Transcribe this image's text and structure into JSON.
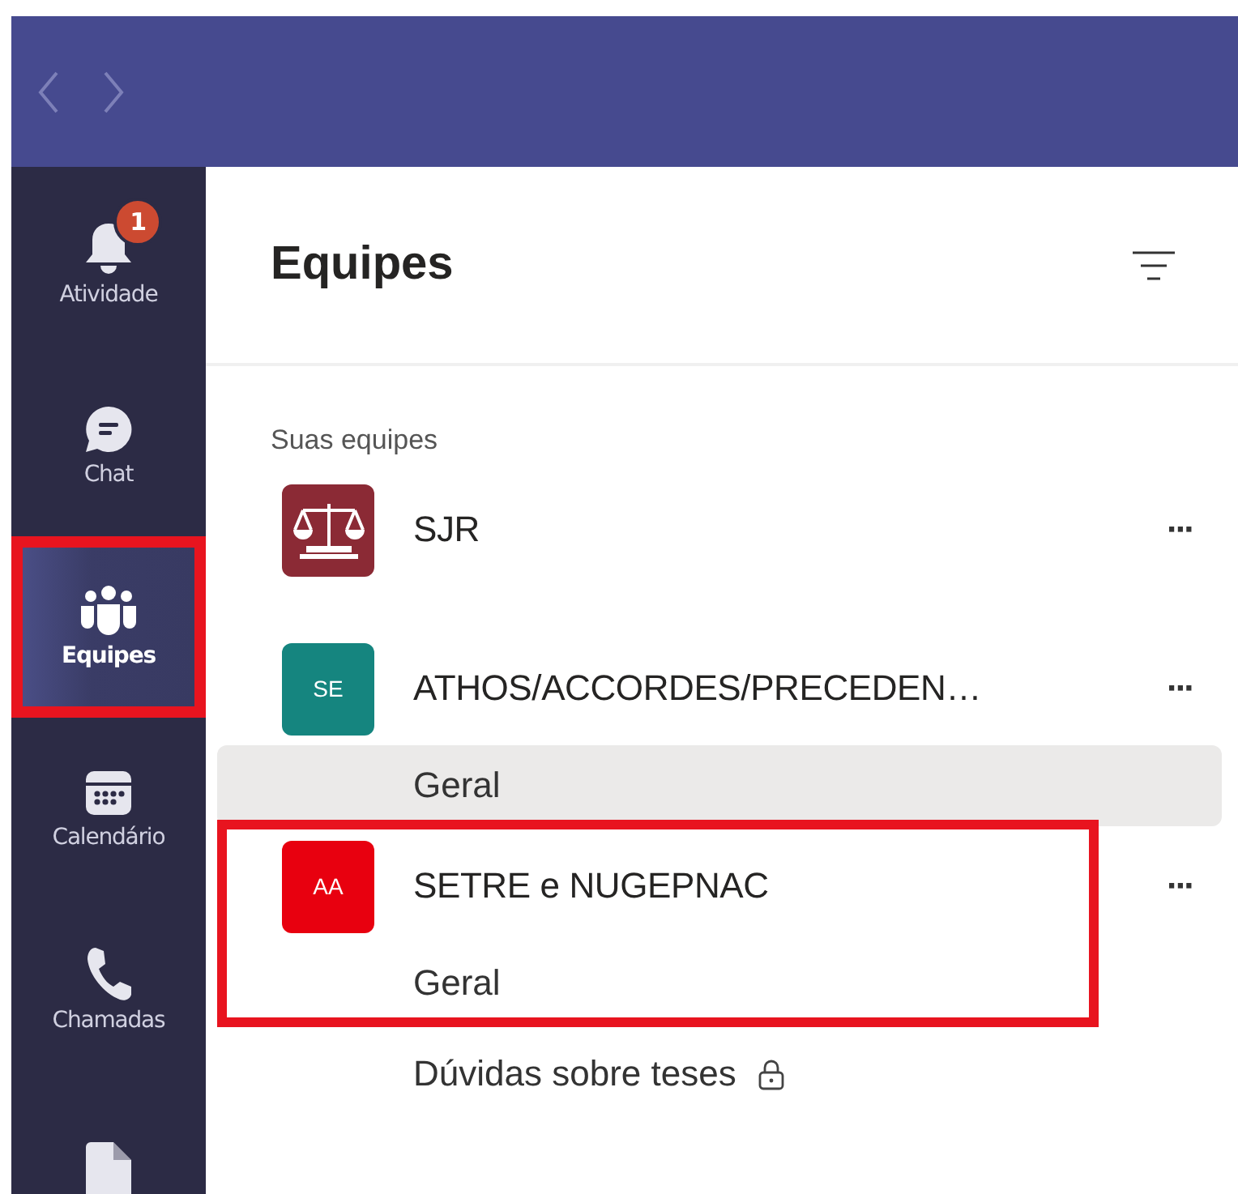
{
  "nav_buttons": [
    {
      "kind": "back"
    },
    {
      "kind": "forward"
    }
  ],
  "rail": {
    "items": [
      {
        "label": "Atividade",
        "kind": "bell",
        "badge": "1",
        "selected": false,
        "highlighted": false
      },
      {
        "label": "Chat",
        "kind": "chat",
        "selected": false,
        "highlighted": false
      },
      {
        "label": "Equipes",
        "kind": "teams",
        "selected": true,
        "highlighted": true
      },
      {
        "label": "Calendário",
        "kind": "calendar",
        "selected": false,
        "highlighted": false
      },
      {
        "label": "Chamadas",
        "kind": "phone",
        "selected": false,
        "highlighted": false
      },
      {
        "kind": "file",
        "selected": false,
        "highlighted": false
      }
    ]
  },
  "panel": {
    "title": "Equipes",
    "section": "Suas equipes",
    "teams": [
      {
        "name": "SJR",
        "avatar": {
          "kind": "logo",
          "color": "#8b2a35"
        },
        "highlighted": false,
        "more": "···"
      },
      {
        "name": "ATHOS/ACCORDES/PRECEDEN…",
        "avatar": {
          "kind": "initials",
          "initials": "SE",
          "color": "#15857f"
        },
        "highlighted": false,
        "more": "···",
        "channels": [
          {
            "name": "Geral",
            "selected": true,
            "private": false
          }
        ]
      },
      {
        "name": "SETRE e NUGEPNAC",
        "avatar": {
          "kind": "initials",
          "initials": "AA",
          "color": "#e8000f"
        },
        "highlighted": true,
        "more": "···",
        "channels": [
          {
            "name": "Geral",
            "selected": false,
            "private": false
          },
          {
            "name": "Dúvidas sobre teses",
            "selected": false,
            "private": true
          }
        ]
      }
    ]
  }
}
